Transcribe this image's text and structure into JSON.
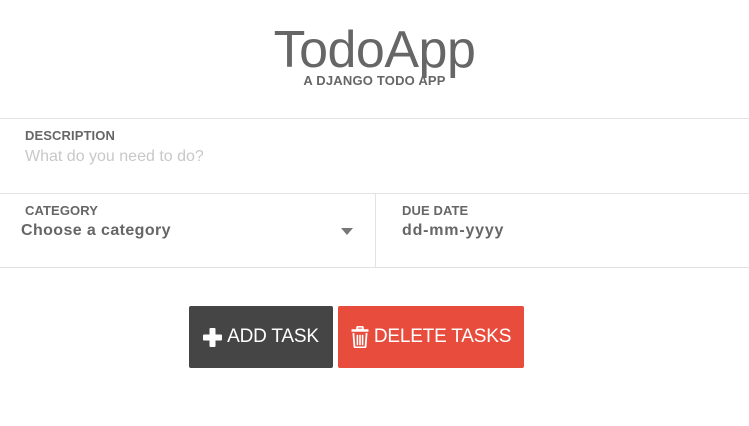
{
  "header": {
    "title": "TodoApp",
    "subtitle": "A DJANGO TODO APP"
  },
  "form": {
    "description": {
      "label": "DESCRIPTION",
      "value": "",
      "placeholder": "What do you need to do?"
    },
    "category": {
      "label": "CATEGORY",
      "selected": "Choose a category",
      "icon": "chevron-down-icon"
    },
    "due_date": {
      "label": "DUE DATE",
      "value": "dd-mm-yyyy"
    }
  },
  "actions": {
    "add_label": "ADD TASK",
    "add_icon": "plus-icon",
    "delete_label": "DELETE TASKS",
    "delete_icon": "trash-icon"
  },
  "colors": {
    "text": "#666666",
    "placeholder": "#c8c8c8",
    "divider": "#e2e2e2",
    "add_button": "#454545",
    "delete_button": "#e74c3c"
  }
}
